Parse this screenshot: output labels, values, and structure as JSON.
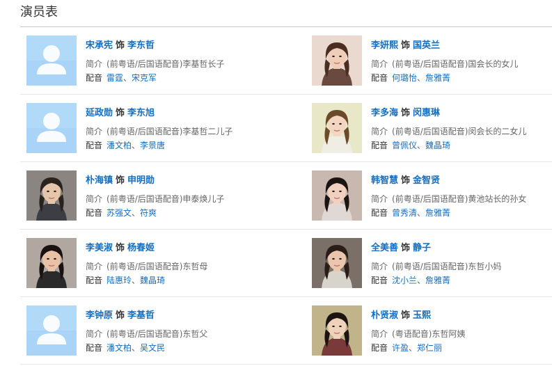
{
  "section_title": "演员表",
  "as_word": "饰",
  "intro_label": "简介",
  "voice_label": "配音",
  "voice_sep": "、",
  "colors": {
    "link": "#136ec2",
    "text": "#333333",
    "muted": "#666666",
    "placeholder_bg": "#a9d4f7"
  },
  "cast": [
    {
      "actor": "宋承宪",
      "role": "李东哲",
      "intro": "(前粤语/后国语配音)李基哲长子",
      "voices": [
        "雷霆",
        "宋克军"
      ],
      "photo": "placeholder-avatar-icon"
    },
    {
      "actor": "李妍熙",
      "role": "国英兰",
      "intro": "(前粤语/后国语配音)国会长的女儿",
      "voices": [
        "何璐怡",
        "詹雅菁"
      ],
      "photo": "actress-photo"
    },
    {
      "actor": "延政勋",
      "role": "李东旭",
      "intro": "(前粤语/后国语配音)李基哲二儿子",
      "voices": [
        "潘文柏",
        "李景唐"
      ],
      "photo": "placeholder-avatar-icon"
    },
    {
      "actor": "李多海",
      "role": "闵惠琳",
      "intro": "(前粤语/后国语配音)闵会长的二女儿",
      "voices": [
        "曾佩仪",
        "魏晶琦"
      ],
      "photo": "actress-photo"
    },
    {
      "actor": "朴海镇",
      "role": "申明勋",
      "intro": "(前粤语/后国语配音)申泰焕儿子",
      "voices": [
        "苏强文",
        "符爽"
      ],
      "photo": "actor-photo"
    },
    {
      "actor": "韩智慧",
      "role": "金智贤",
      "intro": "(前粤语/后国语配音)黄池站长的孙女",
      "voices": [
        "曾秀清",
        "詹雅菁"
      ],
      "photo": "actress-photo"
    },
    {
      "actor": "李美淑",
      "role": "杨春姬",
      "intro": "(前粤语/后国语配音)东哲母",
      "voices": [
        "陆惠玲",
        "魏晶琦"
      ],
      "photo": "actress-photo"
    },
    {
      "actor": "全美善",
      "role": "静子",
      "intro": "(前粤语/后国语配音)东哲小妈",
      "voices": [
        "沈小兰",
        "詹雅菁"
      ],
      "photo": "actress-photo"
    },
    {
      "actor": "李钟原",
      "role": "李基哲",
      "intro": "(前粤语/后国语配音)东哲父",
      "voices": [
        "潘文柏",
        "吴文民"
      ],
      "photo": "placeholder-avatar-icon"
    },
    {
      "actor": "朴贤淑",
      "role": "玉熙",
      "intro": "(粤语配音)东哲阿姨",
      "voices": [
        "许盈",
        "郑仁丽"
      ],
      "photo": "actress-photo"
    }
  ]
}
